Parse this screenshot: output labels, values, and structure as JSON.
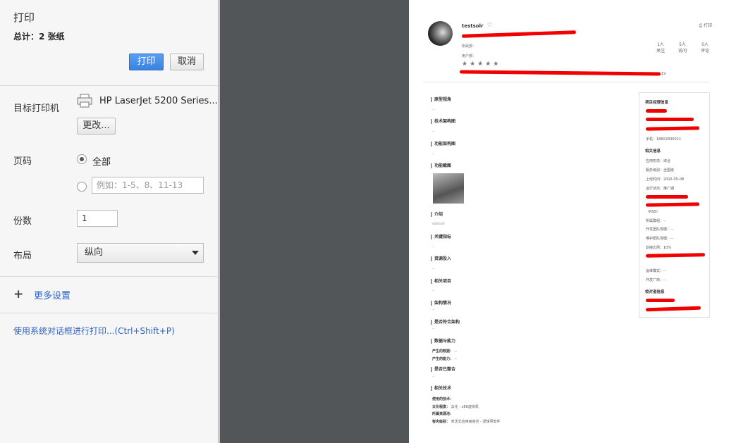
{
  "panel": {
    "title": "打印",
    "total": "总计：2 张纸",
    "print_btn": "打印",
    "cancel_btn": "取消",
    "destination_label": "目标打印机",
    "printer_name": "HP LaserJet 5200 Series...",
    "change_btn": "更改...",
    "pages_label": "页码",
    "pages_all": "全部",
    "pages_placeholder": "例如：1-5、8、11-13",
    "copies_label": "份数",
    "copies_value": "1",
    "layout_label": "布局",
    "layout_value": "纵向",
    "more_settings": "更多设置",
    "system_dialog": "使用系统对话框进行打印...(Ctrl+Shift+P)"
  },
  "preview": {
    "username": "testsolr",
    "print_link": "打印",
    "stats": [
      {
        "num": "1人",
        "label": "关注"
      },
      {
        "num": "5人",
        "label": "访问"
      },
      {
        "num": "0人",
        "label": "评论"
      }
    ],
    "owner_label": "所属部：",
    "user_label": "用户部：",
    "stars": "★★★★★",
    "trail": "19",
    "sections": [
      "原型视角",
      "技术架构图",
      "功能架构图",
      "功能截图",
      "介绍",
      "关键指标",
      "资源投入",
      "相关项目",
      "架构情况",
      "是否符合架构",
      "数据与能力",
      "是否已整合",
      "相关技术"
    ],
    "dash": "--",
    "intro_text": "solrsolr",
    "data_items": [
      {
        "k": "产生的数据：",
        "v": "--"
      },
      {
        "k": "产生的能力：",
        "v": "--"
      }
    ],
    "tech_items": [
      {
        "k": "使用的技术：",
        "v": ""
      },
      {
        "k": "云化程度：",
        "v": "云化 - x86虚拟机"
      },
      {
        "k": "所属资源池：",
        "v": ""
      },
      {
        "k": "容灾级别：",
        "v": "单活式应用级容灾 - 逻辑导软件"
      }
    ],
    "box": {
      "h1": "项目经理信息",
      "phone": "手机：18602830011",
      "h2": "相关信息",
      "items": [
        "应用形态：综合",
        "服务级别：全国级",
        "上线时间：2016-05-08",
        "运行状态：推广期"
      ],
      "rss": "（RSS）",
      "items2": [
        "所属群组：--",
        "开发团队规模：--",
        "维护团队规模：--",
        "割接比例：10%"
      ],
      "items3": [
        "运维模式：--",
        "开发厂商：--"
      ],
      "h3": "校对者信息"
    }
  }
}
